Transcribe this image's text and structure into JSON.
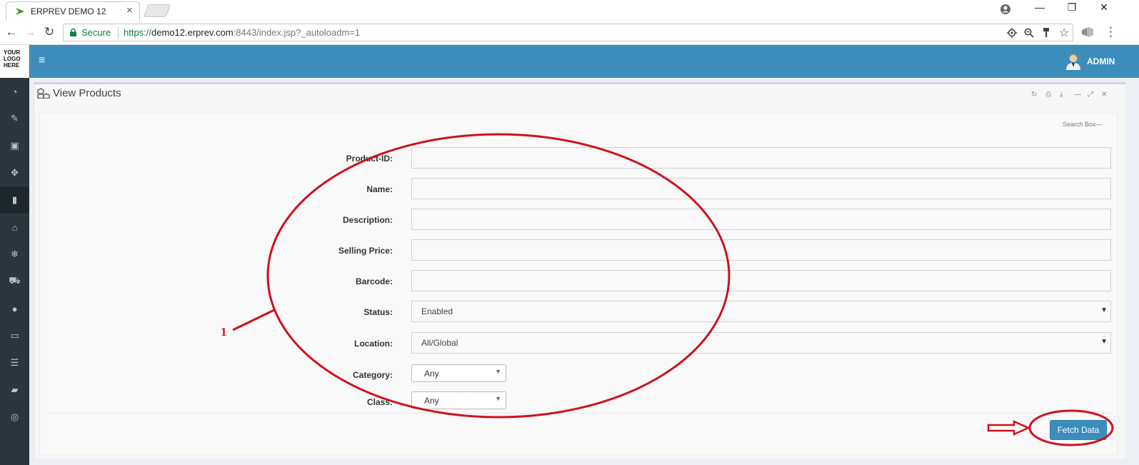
{
  "browser": {
    "tab_title": "ERPREV DEMO 12",
    "tab_close": "×",
    "secure_label": "Secure",
    "url_scheme": "https://",
    "url_host": "demo12.erprev.com",
    "url_rest": ":8443/index.jsp?_autoloadm=1",
    "window_controls": {
      "minimize": "—",
      "restore": "❐",
      "close": "✕"
    },
    "nav": {
      "back": "←",
      "forward": "→",
      "reload": "↻"
    },
    "omnibox_icons": [
      "location-icon",
      "zoom-icon",
      "key-icon",
      "bookmark-star-icon"
    ],
    "menu_glyph": "⋮"
  },
  "app": {
    "logo_text": "YOUR\nLOGO\nHERE",
    "menu_glyph": "≡",
    "user_name": "ADMIN",
    "header_color": "#3c8dbc",
    "sidebar_color": "#2b363e",
    "sidebar_icons": [
      {
        "name": "dashboard-icon",
        "glyph": "◔"
      },
      {
        "name": "tag-icon",
        "glyph": "✎"
      },
      {
        "name": "money-icon",
        "glyph": "▣"
      },
      {
        "name": "cubes-icon",
        "glyph": "✥"
      },
      {
        "name": "building-icon",
        "glyph": "▮"
      },
      {
        "name": "trash-icon",
        "glyph": "⌂"
      },
      {
        "name": "snowflake-icon",
        "glyph": "❄"
      },
      {
        "name": "cart-icon",
        "glyph": "⛟"
      },
      {
        "name": "circle-icon",
        "glyph": "●"
      },
      {
        "name": "desktop-icon",
        "glyph": "▭"
      },
      {
        "name": "database-icon",
        "glyph": "☰"
      },
      {
        "name": "book-icon",
        "glyph": "▰"
      },
      {
        "name": "lifebuoy-icon",
        "glyph": "◎"
      }
    ]
  },
  "panel": {
    "title": "View Products",
    "controls": [
      "↻",
      "⎙",
      "⤓",
      "—",
      "⤢",
      "✕"
    ],
    "search_box_label": "Search Box",
    "search_box_toggle": "—",
    "fields": [
      {
        "label": "Product-ID:",
        "value": ""
      },
      {
        "label": "Name:",
        "value": ""
      },
      {
        "label": "Description:",
        "value": ""
      },
      {
        "label": "Selling Price:",
        "value": ""
      },
      {
        "label": "Barcode:",
        "value": ""
      },
      {
        "label": "Status:",
        "value": "Enabled"
      },
      {
        "label": "Location:",
        "value": "All/Global"
      },
      {
        "label": "Category:",
        "value": "Any"
      },
      {
        "label": "Class:",
        "value": "Any"
      }
    ],
    "fetch_button": "Fetch Data"
  },
  "annotation": {
    "number": "1",
    "color": "#d0101e"
  }
}
